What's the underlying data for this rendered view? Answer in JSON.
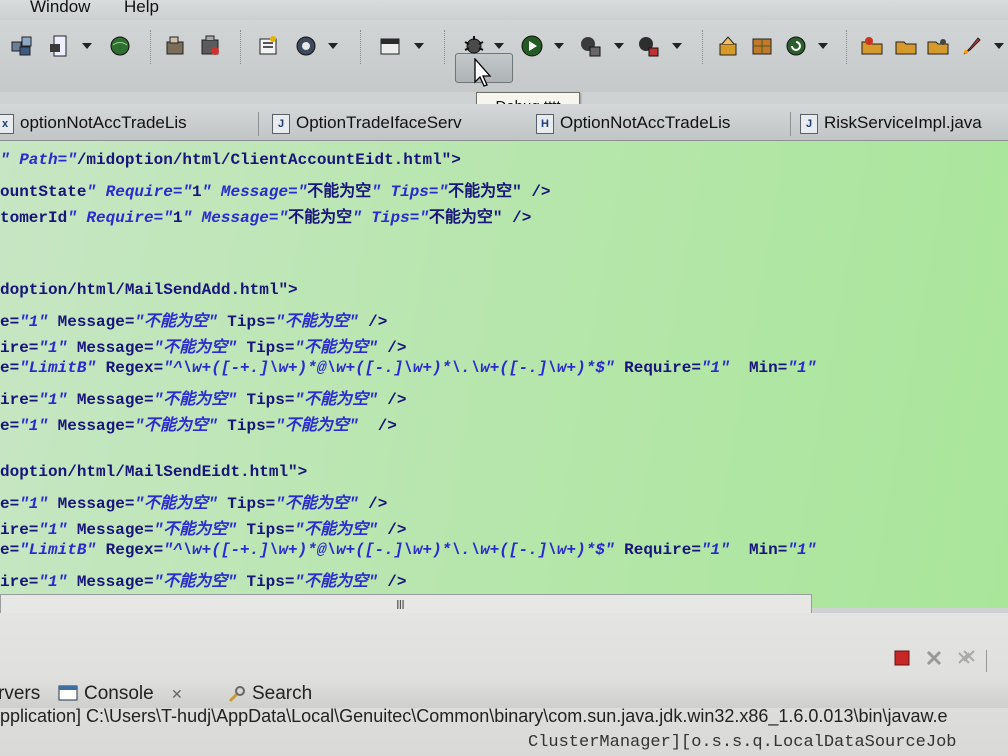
{
  "menu": {
    "items": [
      "Window",
      "Help"
    ]
  },
  "toolbar": {
    "icons": [
      "new-wizard-icon",
      "deploy-icon",
      "server-icon",
      "open-type-icon",
      "open-task-icon",
      "new-package-icon",
      "web-browser-icon",
      "open-perspective-icon",
      "debug-icon",
      "run-icon",
      "coverage-icon",
      "external-tools-icon",
      "add-jar-icon",
      "bundle-icon",
      "refresh-icon",
      "open-folder-icon",
      "save-icon",
      "launch-icon",
      "rocket-icon"
    ]
  },
  "tooltip": {
    "text": "Debug tttt"
  },
  "tabs": [
    {
      "label": "optionNotAccTradeLis",
      "icon": "xml-file-icon"
    },
    {
      "label": "OptionTradeIfaceServ",
      "icon": "java-file-icon"
    },
    {
      "label": "OptionNotAccTradeLis",
      "icon": "html-file-icon"
    },
    {
      "label": "RiskServiceImpl.java",
      "icon": "java-file-icon"
    }
  ],
  "editor": {
    "lines": [
      "\" Path=\"/midoption/html/ClientAccountEidt.html\">",
      "ountState\" Require=\"1\" Message=\"不能为空\" Tips=\"不能为空\" />",
      "tomerId\" Require=\"1\" Message=\"不能为空\" Tips=\"不能为空\" />",
      "",
      "",
      "doption/html/MailSendAdd.html\">",
      "e=\"1\" Message=\"不能为空\" Tips=\"不能为空\" />",
      "ire=\"1\" Message=\"不能为空\" Tips=\"不能为空\" />",
      "e=\"LimitB\" Regex=\"^\\w+([-+.]\\w+)*@\\w+([-.]\\w+)*\\.\\w+([-.]\\w+)*$\" Require=\"1\"  Min=\"1\"",
      "ire=\"1\" Message=\"不能为空\" Tips=\"不能为空\" />",
      "e=\"1\" Message=\"不能为空\" Tips=\"不能为空\"  />",
      "",
      "doption/html/MailSendEidt.html\">",
      "e=\"1\" Message=\"不能为空\" Tips=\"不能为空\" />",
      "ire=\"1\" Message=\"不能为空\" Tips=\"不能为空\" />",
      "e=\"LimitB\" Regex=\"^\\w+([-+.]\\w+)*@\\w+([-.]\\w+)*\\.\\w+([-.]\\w+)*$\" Require=\"1\"  Min=\"1\"",
      "ire=\"1\" Message=\"不能为空\" Tips=\"不能为空\" />",
      "re=\"1\" Message=\"不能为空\" Tips=\"不能为空\"  />"
    ],
    "scroll_thumb": "III"
  },
  "bottom": {
    "tabs": [
      {
        "label": "rvers"
      },
      {
        "label": "Console",
        "close": "✕"
      },
      {
        "label": "Search"
      }
    ],
    "console_header": "pplication] C:\\Users\\T-hudj\\AppData\\Local\\Genuitec\\Common\\binary\\com.sun.java.jdk.win32.x86_1.6.0.013\\bin\\javaw.e",
    "console_line": "ClusterManager][o.s.s.q.LocalDataSourceJob"
  },
  "colors": {
    "editor_bg": "#b8e6ae",
    "keyword": "#17147a",
    "string": "#2a2ad0"
  }
}
